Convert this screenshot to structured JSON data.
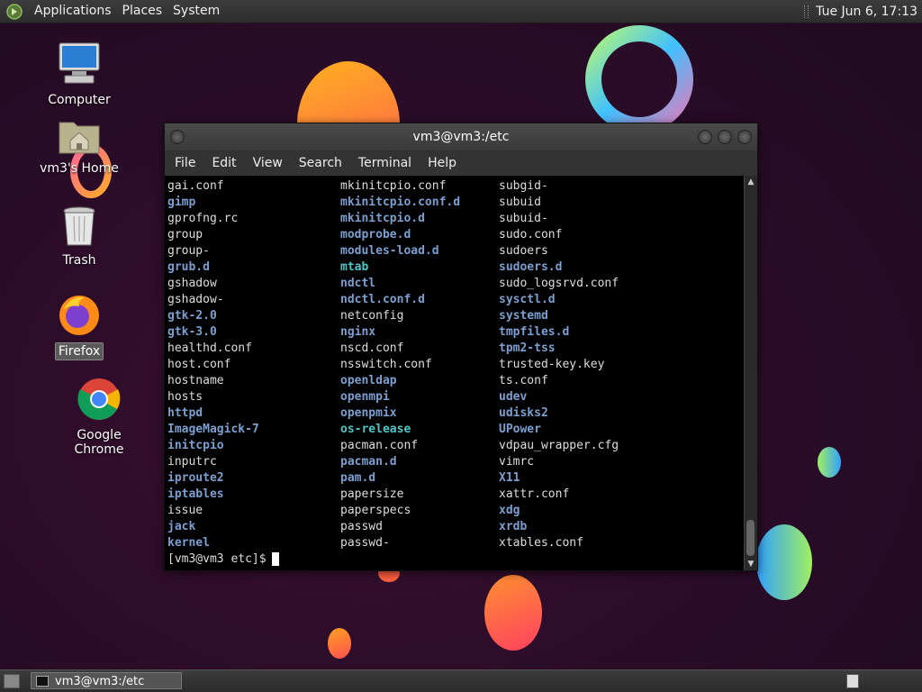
{
  "top_panel": {
    "menus": [
      "Applications",
      "Places",
      "System"
    ],
    "clock": "Tue Jun  6, 17:13"
  },
  "desktop_icons": [
    {
      "label": "Computer",
      "icon": "computer-icon"
    },
    {
      "label": "vm3's Home",
      "icon": "home-folder-icon"
    },
    {
      "label": "Trash",
      "icon": "trash-icon"
    },
    {
      "label": "Firefox",
      "icon": "firefox-icon"
    },
    {
      "label": "Google Chrome",
      "icon": "chrome-icon"
    }
  ],
  "terminal": {
    "title": "vm3@vm3:/etc",
    "menus": [
      "File",
      "Edit",
      "View",
      "Search",
      "Terminal",
      "Help"
    ],
    "columns": [
      [
        {
          "name": "gai.conf",
          "type": "file"
        },
        {
          "name": "gimp",
          "type": "dir"
        },
        {
          "name": "gprofng.rc",
          "type": "file"
        },
        {
          "name": "group",
          "type": "file"
        },
        {
          "name": "group-",
          "type": "file"
        },
        {
          "name": "grub.d",
          "type": "dir"
        },
        {
          "name": "gshadow",
          "type": "file"
        },
        {
          "name": "gshadow-",
          "type": "file"
        },
        {
          "name": "gtk-2.0",
          "type": "dir"
        },
        {
          "name": "gtk-3.0",
          "type": "dir"
        },
        {
          "name": "healthd.conf",
          "type": "file"
        },
        {
          "name": "host.conf",
          "type": "file"
        },
        {
          "name": "hostname",
          "type": "file"
        },
        {
          "name": "hosts",
          "type": "file"
        },
        {
          "name": "httpd",
          "type": "dir"
        },
        {
          "name": "ImageMagick-7",
          "type": "dir"
        },
        {
          "name": "initcpio",
          "type": "dir"
        },
        {
          "name": "inputrc",
          "type": "file"
        },
        {
          "name": "iproute2",
          "type": "dir"
        },
        {
          "name": "iptables",
          "type": "dir"
        },
        {
          "name": "issue",
          "type": "file"
        },
        {
          "name": "jack",
          "type": "dir"
        },
        {
          "name": "kernel",
          "type": "dir"
        }
      ],
      [
        {
          "name": "mkinitcpio.conf",
          "type": "file"
        },
        {
          "name": "mkinitcpio.conf.d",
          "type": "dir"
        },
        {
          "name": "mkinitcpio.d",
          "type": "dir"
        },
        {
          "name": "modprobe.d",
          "type": "dir"
        },
        {
          "name": "modules-load.d",
          "type": "dir"
        },
        {
          "name": "mtab",
          "type": "link"
        },
        {
          "name": "ndctl",
          "type": "dir"
        },
        {
          "name": "ndctl.conf.d",
          "type": "dir"
        },
        {
          "name": "netconfig",
          "type": "file"
        },
        {
          "name": "nginx",
          "type": "dir"
        },
        {
          "name": "nscd.conf",
          "type": "file"
        },
        {
          "name": "nsswitch.conf",
          "type": "file"
        },
        {
          "name": "openldap",
          "type": "dir"
        },
        {
          "name": "openmpi",
          "type": "dir"
        },
        {
          "name": "openpmix",
          "type": "dir"
        },
        {
          "name": "os-release",
          "type": "link"
        },
        {
          "name": "pacman.conf",
          "type": "file"
        },
        {
          "name": "pacman.d",
          "type": "dir"
        },
        {
          "name": "pam.d",
          "type": "dir"
        },
        {
          "name": "papersize",
          "type": "file"
        },
        {
          "name": "paperspecs",
          "type": "file"
        },
        {
          "name": "passwd",
          "type": "file"
        },
        {
          "name": "passwd-",
          "type": "file"
        }
      ],
      [
        {
          "name": "subgid-",
          "type": "file"
        },
        {
          "name": "subuid",
          "type": "file"
        },
        {
          "name": "subuid-",
          "type": "file"
        },
        {
          "name": "sudo.conf",
          "type": "file"
        },
        {
          "name": "sudoers",
          "type": "file"
        },
        {
          "name": "sudoers.d",
          "type": "dir"
        },
        {
          "name": "sudo_logsrvd.conf",
          "type": "file"
        },
        {
          "name": "sysctl.d",
          "type": "dir"
        },
        {
          "name": "systemd",
          "type": "dir"
        },
        {
          "name": "tmpfiles.d",
          "type": "dir"
        },
        {
          "name": "tpm2-tss",
          "type": "dir"
        },
        {
          "name": "trusted-key.key",
          "type": "file"
        },
        {
          "name": "ts.conf",
          "type": "file"
        },
        {
          "name": "udev",
          "type": "dir"
        },
        {
          "name": "udisks2",
          "type": "dir"
        },
        {
          "name": "UPower",
          "type": "dir"
        },
        {
          "name": "vdpau_wrapper.cfg",
          "type": "file"
        },
        {
          "name": "vimrc",
          "type": "file"
        },
        {
          "name": "X11",
          "type": "dir"
        },
        {
          "name": "xattr.conf",
          "type": "file"
        },
        {
          "name": "xdg",
          "type": "dir"
        },
        {
          "name": "xrdb",
          "type": "dir"
        },
        {
          "name": "xtables.conf",
          "type": "file"
        }
      ]
    ],
    "prompt": "[vm3@vm3 etc]$"
  },
  "taskbar": {
    "task_label": "vm3@vm3:/etc"
  },
  "colors": {
    "dir": "#7b9fd0",
    "link": "#4ec6c6",
    "file": "#dddddd"
  }
}
